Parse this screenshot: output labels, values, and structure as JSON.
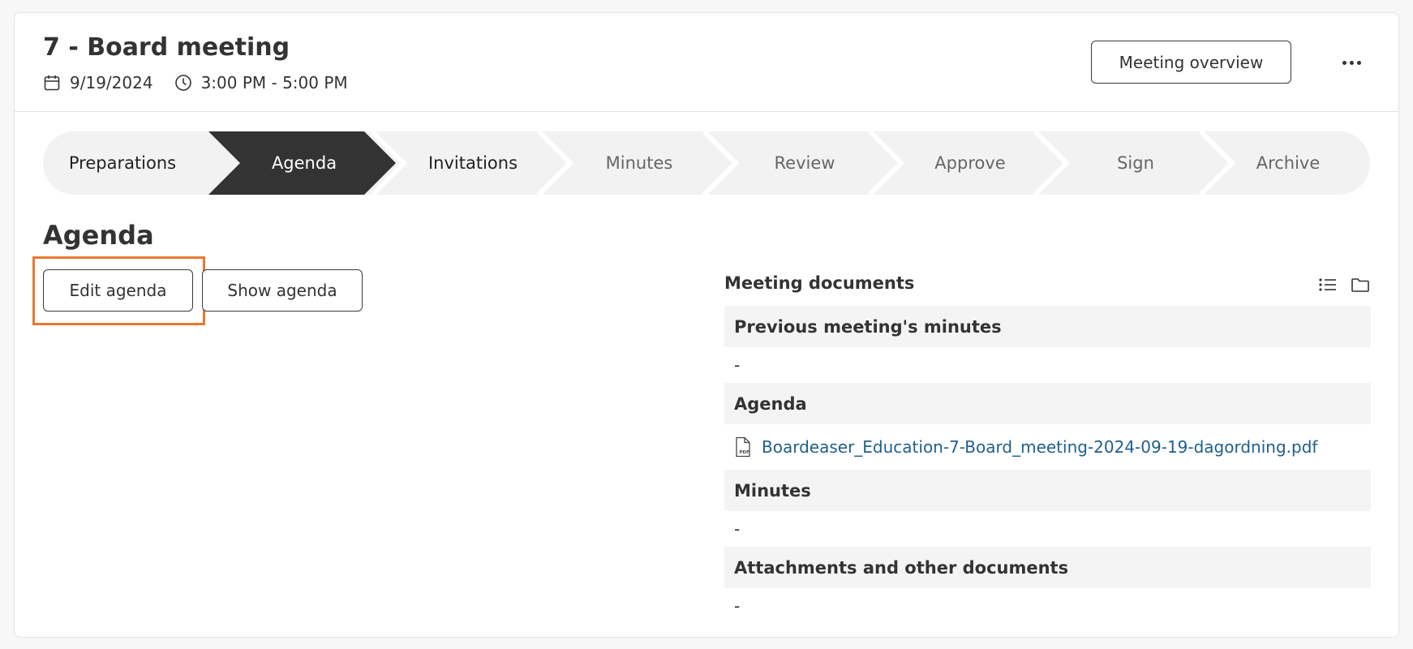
{
  "meeting": {
    "title": "7 - Board meeting",
    "date": "9/19/2024",
    "time": "3:00 PM - 5:00 PM",
    "overview_label": "Meeting overview",
    "more_icon": "more-horizontal-icon"
  },
  "stepper": {
    "steps": [
      {
        "label": "Preparations",
        "state": "completed"
      },
      {
        "label": "Agenda",
        "state": "current"
      },
      {
        "label": "Invitations",
        "state": "completed"
      },
      {
        "label": "Minutes",
        "state": "upcoming"
      },
      {
        "label": "Review",
        "state": "upcoming"
      },
      {
        "label": "Approve",
        "state": "upcoming"
      },
      {
        "label": "Sign",
        "state": "upcoming"
      },
      {
        "label": "Archive",
        "state": "upcoming"
      }
    ],
    "colors": {
      "track": "#f2f2f2",
      "current": "#333333",
      "current_text": "#ffffff",
      "completed_text": "#222222",
      "upcoming_text": "#666666"
    }
  },
  "agenda": {
    "heading": "Agenda",
    "edit_label": "Edit agenda",
    "show_label": "Show agenda",
    "highlight_color": "#e8792f"
  },
  "documents": {
    "title": "Meeting documents",
    "list_icon": "list-view-icon",
    "folder_icon": "folder-icon",
    "groups": [
      {
        "label": "Previous meeting's minutes",
        "empty": "-"
      },
      {
        "label": "Agenda",
        "file": "Boardeaser_Education-7-Board_meeting-2024-09-19-dagordning.pdf"
      },
      {
        "label": "Minutes",
        "empty": "-"
      },
      {
        "label": "Attachments and other documents",
        "empty": "-"
      }
    ],
    "link_color": "#1f5f8b"
  }
}
